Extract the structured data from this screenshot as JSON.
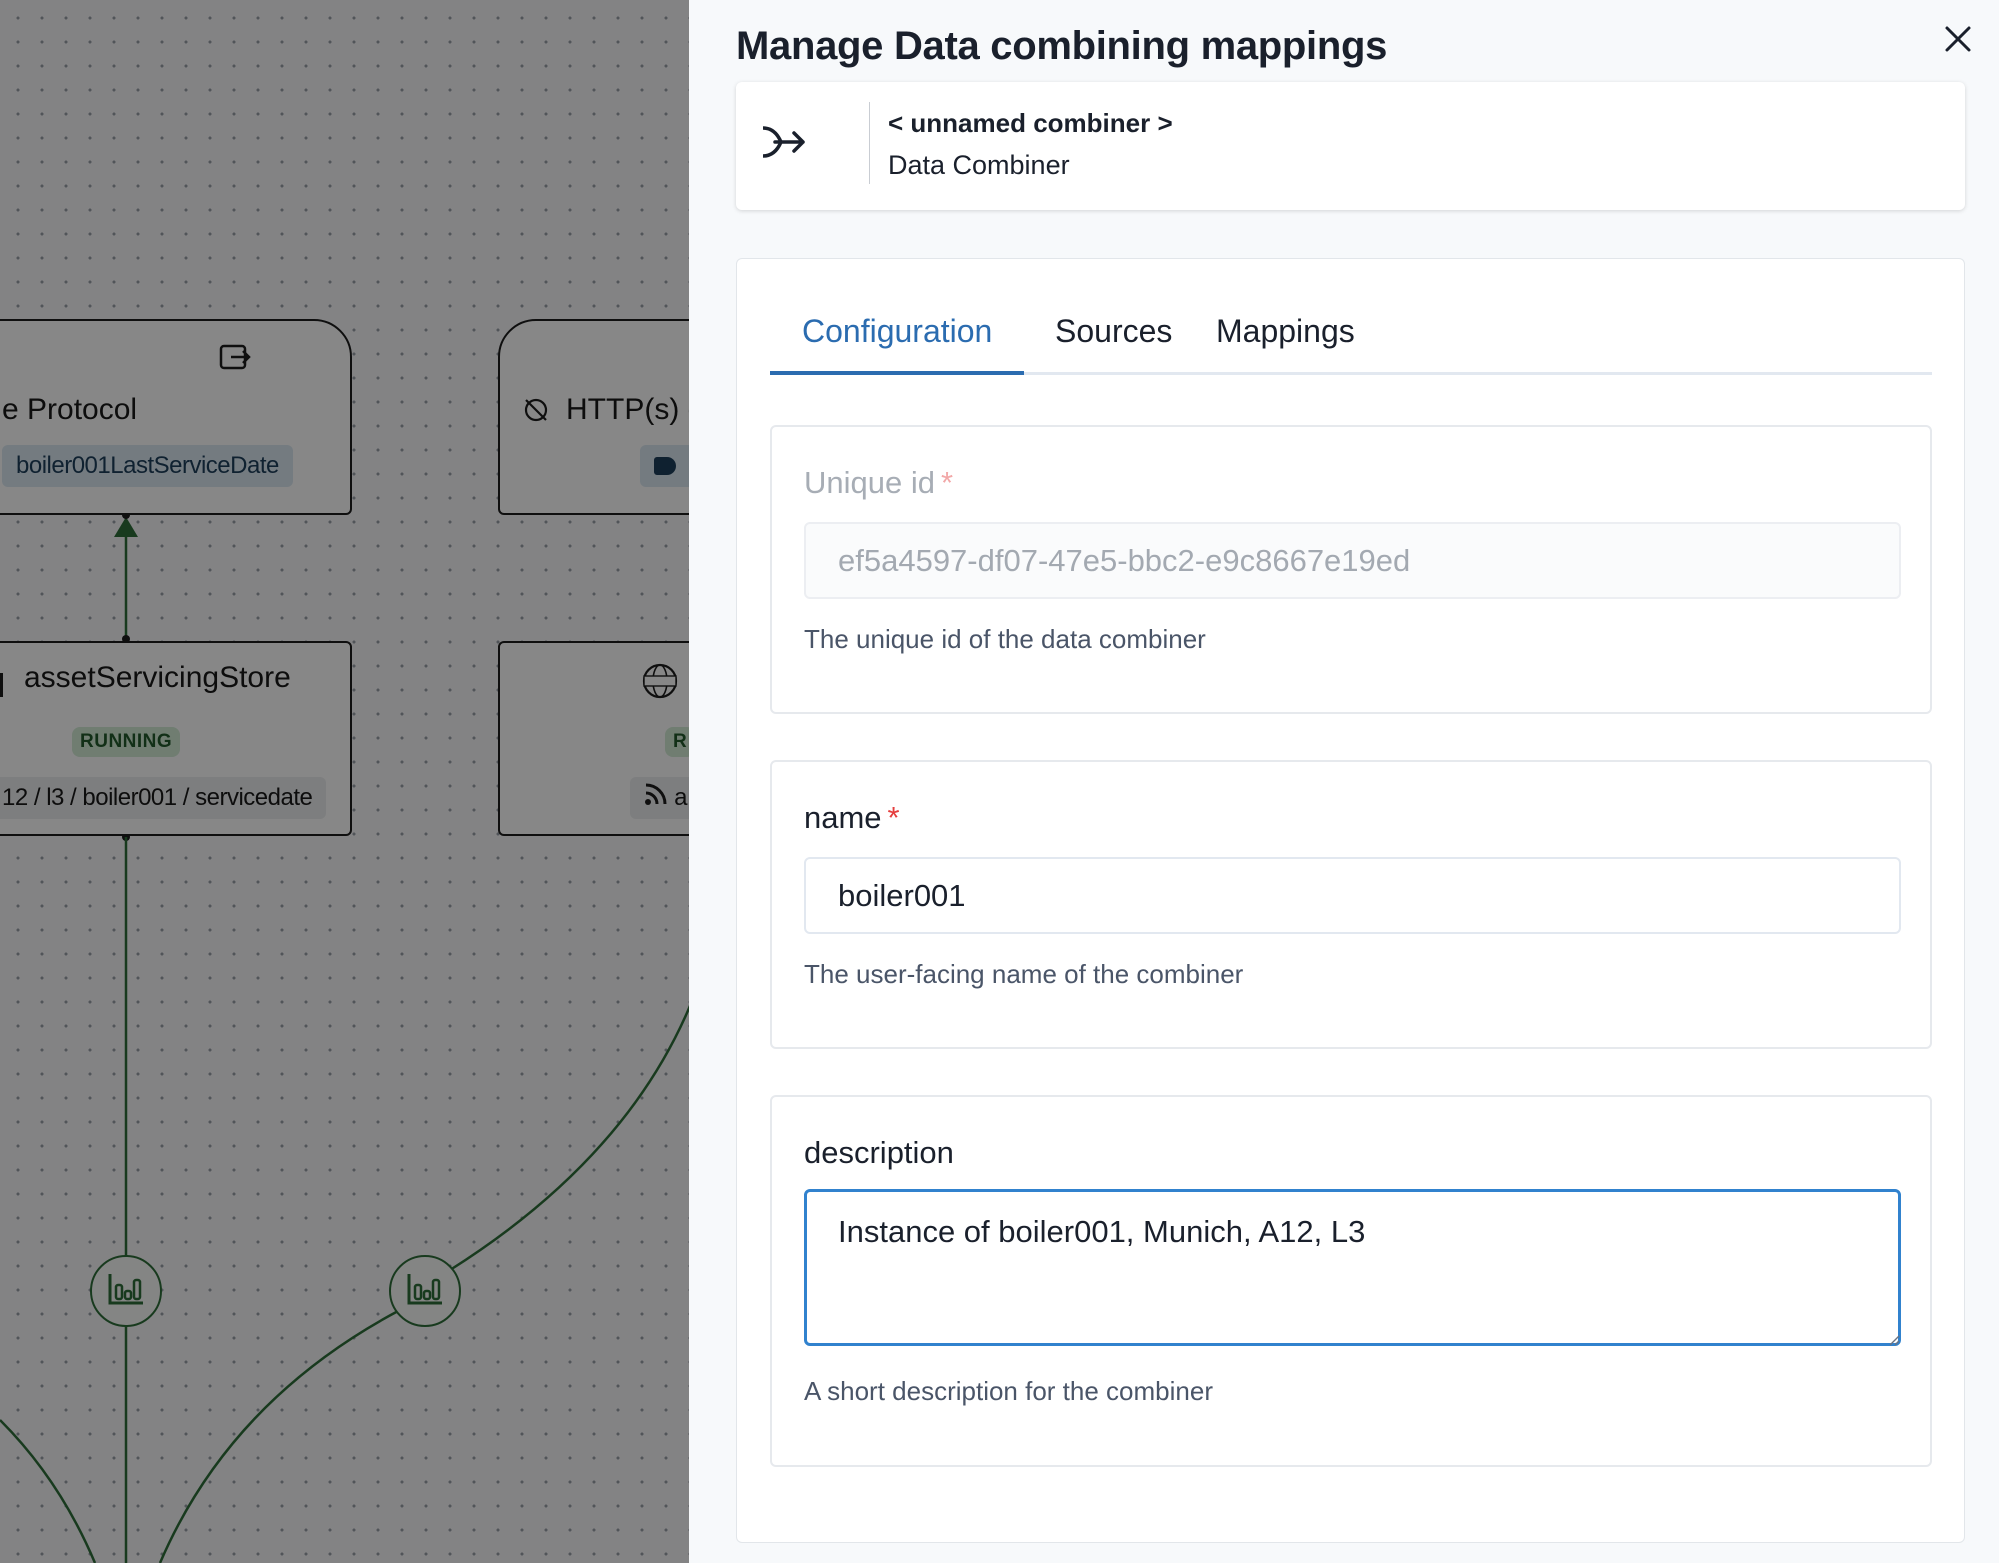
{
  "canvas": {
    "node_protocol": {
      "label": "e Protocol",
      "tag": "boiler001LastServiceDate"
    },
    "node_http": {
      "label": "HTTP(s) c"
    },
    "node_store": {
      "label": "assetServicingStore",
      "status": "RUNNING",
      "topic": "12 / l3 / boiler001 / servicedate"
    },
    "node_http_adapter": {
      "status_partial": "R",
      "topic_partial": "a"
    }
  },
  "drawer": {
    "title": "Manage Data combining mappings",
    "close_icon": "close-icon",
    "combiner": {
      "icon": "merge-arrow-icon",
      "name": "< unnamed combiner >",
      "type": "Data Combiner"
    },
    "tabs": [
      {
        "label": "Configuration",
        "active": true
      },
      {
        "label": "Sources",
        "active": false
      },
      {
        "label": "Mappings",
        "active": false
      }
    ],
    "fields": {
      "unique_id": {
        "label": "Unique id",
        "required_mark": "*",
        "value": "ef5a4597-df07-47e5-bbc2-e9c8667e19ed",
        "helper": "The unique id of the data combiner",
        "disabled": true
      },
      "name": {
        "label": "name",
        "required_mark": "*",
        "value": "boiler001",
        "helper": "The user-facing name of the combiner"
      },
      "description": {
        "label": "description",
        "value": "Instance of boiler001, Munich, A12, L3",
        "helper": "A short description for the combiner"
      }
    }
  },
  "colors": {
    "accent": "#2b6cb0",
    "focus": "#3182ce",
    "required": "#e53e3e",
    "status_running_bg": "#d3ecd6",
    "edge": "#2f6f3a"
  }
}
